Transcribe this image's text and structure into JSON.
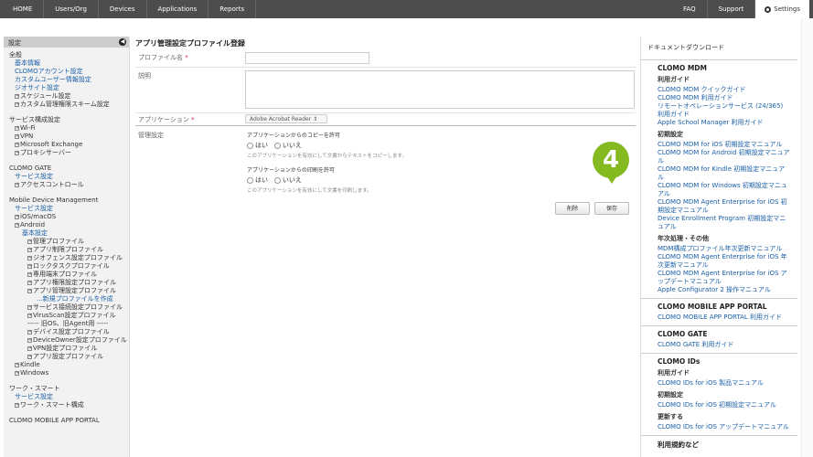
{
  "topnav": {
    "left": [
      "HOME",
      "Users/Org",
      "Devices",
      "Applications",
      "Reports"
    ],
    "faq": "FAQ",
    "support": "Support",
    "settings": "Settings"
  },
  "sidebar": {
    "header": "設定",
    "items": [
      {
        "text": "全般",
        "level": 0,
        "link": false,
        "pm": false,
        "gap": false
      },
      {
        "text": "基本情報",
        "level": 1,
        "link": true,
        "pm": false
      },
      {
        "text": "CLOMOアカウント設定",
        "level": 1,
        "link": true,
        "pm": false
      },
      {
        "text": "カスタムユーザー情報設定",
        "level": 1,
        "link": true,
        "pm": false
      },
      {
        "text": "ジオサイト設定",
        "level": 1,
        "link": true,
        "pm": false
      },
      {
        "text": "スケジュール設定",
        "level": 1,
        "link": false,
        "pm": true
      },
      {
        "text": "カスタム管理権限スキーム設定",
        "level": 1,
        "link": false,
        "pm": true
      },
      {
        "text": "サービス構成設定",
        "level": 0,
        "link": false,
        "pm": false,
        "gap": true
      },
      {
        "text": "Wi-Fi",
        "level": 1,
        "link": false,
        "pm": true
      },
      {
        "text": "VPN",
        "level": 1,
        "link": false,
        "pm": true
      },
      {
        "text": "Microsoft Exchange",
        "level": 1,
        "link": false,
        "pm": true
      },
      {
        "text": "プロキシサーバー",
        "level": 1,
        "link": false,
        "pm": true
      },
      {
        "text": "CLOMO GATE",
        "level": 0,
        "link": false,
        "pm": false,
        "gap": true
      },
      {
        "text": "サービス設定",
        "level": 1,
        "link": true,
        "pm": false
      },
      {
        "text": "アクセスコントロール",
        "level": 1,
        "link": false,
        "pm": true
      },
      {
        "text": "Mobile Device Management",
        "level": 0,
        "link": false,
        "pm": false,
        "gap": true
      },
      {
        "text": "サービス設定",
        "level": 1,
        "link": true,
        "pm": false
      },
      {
        "text": "iOS/macOS",
        "level": 1,
        "link": false,
        "pm": true
      },
      {
        "text": "Android",
        "level": 1,
        "link": false,
        "pm": true
      },
      {
        "text": "基本設定",
        "level": 2,
        "link": true,
        "pm": false
      },
      {
        "text": "管理プロファイル",
        "level": 3,
        "link": false,
        "pm": true
      },
      {
        "text": "アプリ制限プロファイル",
        "level": 3,
        "link": false,
        "pm": true
      },
      {
        "text": "ジオフェンス設定プロファイル",
        "level": 3,
        "link": false,
        "pm": true
      },
      {
        "text": "ロックタスクプロファイル",
        "level": 3,
        "link": false,
        "pm": true
      },
      {
        "text": "専用端末プロファイル",
        "level": 3,
        "link": false,
        "pm": true
      },
      {
        "text": "アプリ権限設定プロファイル",
        "level": 3,
        "link": false,
        "pm": true
      },
      {
        "text": "アプリ管理設定プロファイル",
        "level": 3,
        "link": false,
        "pm": true
      },
      {
        "text": "...新規プロファイルを作成",
        "level": 4,
        "link": true,
        "pm": false
      },
      {
        "text": "サービス接続設定プロファイル",
        "level": 3,
        "link": false,
        "pm": true
      },
      {
        "text": "VirusScan設定プロファイル",
        "level": 3,
        "link": false,
        "pm": true
      },
      {
        "text": "----- 旧OS、旧Agent用 -----",
        "level": 3,
        "link": false,
        "pm": false
      },
      {
        "text": "デバイス設定プロファイル",
        "level": 3,
        "link": false,
        "pm": true
      },
      {
        "text": "DeviceOwner設定プロファイル",
        "level": 3,
        "link": false,
        "pm": true
      },
      {
        "text": "VPN設定プロファイル",
        "level": 3,
        "link": false,
        "pm": true
      },
      {
        "text": "アプリ設定プロファイル",
        "level": 3,
        "link": false,
        "pm": true
      },
      {
        "text": "Kindle",
        "level": 1,
        "link": false,
        "pm": true
      },
      {
        "text": "Windows",
        "level": 1,
        "link": false,
        "pm": true
      },
      {
        "text": "ワーク・スマート",
        "level": 0,
        "link": false,
        "pm": false,
        "gap": true
      },
      {
        "text": "サービス設定",
        "level": 1,
        "link": true,
        "pm": false
      },
      {
        "text": "ワーク・スマート構成",
        "level": 1,
        "link": false,
        "pm": true
      },
      {
        "text": "CLOMO MOBILE APP PORTAL",
        "level": 0,
        "link": false,
        "pm": false,
        "gap": true
      }
    ]
  },
  "form": {
    "title": "アプリ管理設定プロファイル登録",
    "profile_name_label": "プロファイル名",
    "required_mark": "*",
    "description_label": "説明",
    "application_label": "アプリケーション",
    "application_value": "Adobe Acrobat Reader",
    "management_label": "管理設定",
    "copy_title": "アプリケーションからのコピーを許可",
    "copy_yes": "はい",
    "copy_no": "いいえ",
    "copy_hint": "このアプリケーションを有効にして文書からテキストをコピーします。",
    "print_title": "アプリケーションからの印刷を許可",
    "print_yes": "はい",
    "print_no": "いいえ",
    "print_hint": "このアプリケーションを有効にして文書を印刷します。",
    "delete_button": "削除",
    "save_button": "保存",
    "step_badge": "4"
  },
  "downloads": {
    "title": "ドキュメントダウンロード",
    "sections": [
      {
        "heading": "CLOMO MDM",
        "groups": [
          {
            "sub": "利用ガイド",
            "links": [
              "CLOMO MDM クイックガイド",
              "CLOMO MDM 利用ガイド",
              "リモートオペレーションサービス (24/365) 利用ガイド",
              "Apple School Manager 利用ガイド"
            ]
          },
          {
            "sub": "初期設定",
            "links": [
              "CLOMO MDM for iOS 初期設定マニュアル",
              "CLOMO MDM for Android 初期設定マニュアル",
              "CLOMO MDM for Kindle 初期設定マニュアル",
              "CLOMO MDM for Windows 初期設定マニュアル",
              "CLOMO MDM Agent Enterprise for iOS 初期設定マニュアル",
              "Device Enrollment Program 初期設定マニュアル"
            ]
          },
          {
            "sub": "年次処理・その他",
            "links": [
              "MDM構成プロファイル年次更新マニュアル",
              "CLOMO MDM Agent Enterprise for iOS 年次更新マニュアル",
              "CLOMO MDM Agent Enterprise for iOS アップデートマニュアル",
              "Apple Configurator 2 操作マニュアル"
            ]
          }
        ]
      },
      {
        "heading": "CLOMO MOBILE APP PORTAL",
        "groups": [
          {
            "sub": "",
            "links": [
              "CLOMO MOBILE APP PORTAL 利用ガイド"
            ]
          }
        ]
      },
      {
        "heading": "CLOMO GATE",
        "groups": [
          {
            "sub": "",
            "links": [
              "CLOMO GATE 利用ガイド"
            ]
          }
        ]
      },
      {
        "heading": "CLOMO IDs",
        "groups": [
          {
            "sub": "利用ガイド",
            "links": [
              "CLOMO IDs for iOS 製品マニュアル"
            ]
          },
          {
            "sub": "初期設定",
            "links": [
              "CLOMO IDs for iOS 初期設定マニュアル"
            ]
          },
          {
            "sub": "更新する",
            "links": [
              "CLOMO IDs for iOS アップデートマニュアル"
            ]
          }
        ]
      },
      {
        "heading": "利用規約など",
        "groups": []
      }
    ]
  }
}
